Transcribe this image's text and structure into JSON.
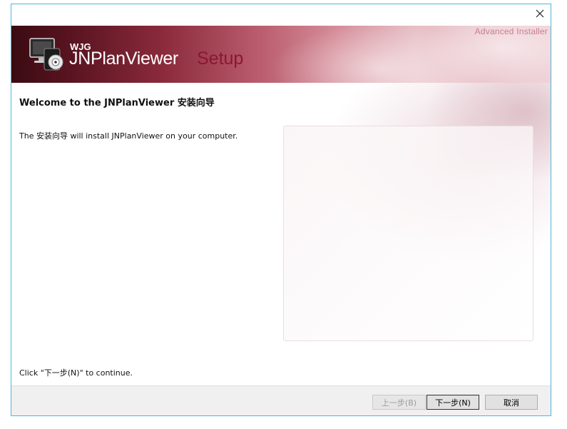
{
  "window": {
    "close_glyph": "✕",
    "accent_color": "#4fb6d8"
  },
  "banner": {
    "watermark": "Advanced Installer",
    "company": "WJG",
    "product": "JNPlanViewer",
    "setup_word": "Setup",
    "icon": "computer-with-cd-icon",
    "setup_color": "#8b1630"
  },
  "content": {
    "title": "Welcome to the JNPlanViewer 安装向导",
    "description": "The 安装向导 will install JNPlanViewer on your computer.",
    "continue_text": "Click \"下一步(N)\" to continue."
  },
  "buttons": {
    "back": "上一步(B)",
    "next": "下一步(N)",
    "cancel": "取消"
  }
}
